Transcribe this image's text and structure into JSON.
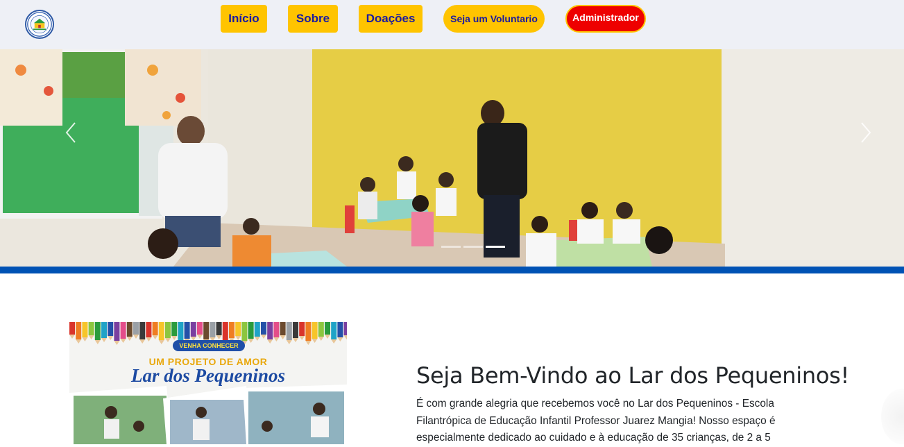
{
  "header": {
    "logo_icon": "school-seal-logo",
    "nav": {
      "inicio": "Início",
      "sobre": "Sobre",
      "doacoes": "Doações",
      "voluntario": "Seja um Voluntario",
      "admin": "Administrador"
    }
  },
  "carousel": {
    "image": "classroom-children-photo",
    "prev_icon": "chevron-left-icon",
    "next_icon": "chevron-right-icon",
    "slide_count": 3,
    "active_slide": 3
  },
  "poster": {
    "badge": "VENHA CONHECER",
    "subtitle": "UM PROJETO DE AMOR",
    "title": "Lar dos Pequeninos"
  },
  "welcome": {
    "title": "Seja Bem-Vindo ao Lar dos Pequeninos!",
    "text": "É com grande alegria que recebemos você no Lar dos Pequeninos - Escola Filantrópica de Educação Infantil Professor Juarez Mangia! Nosso espaço é especialmente dedicado ao cuidado e à educação de 35 crianças, de 2 a 5"
  },
  "colors": {
    "nav_yellow": "#ffc400",
    "nav_text": "#1a1aa0",
    "admin_red": "#ee0000",
    "strip_blue": "#0052b4"
  }
}
